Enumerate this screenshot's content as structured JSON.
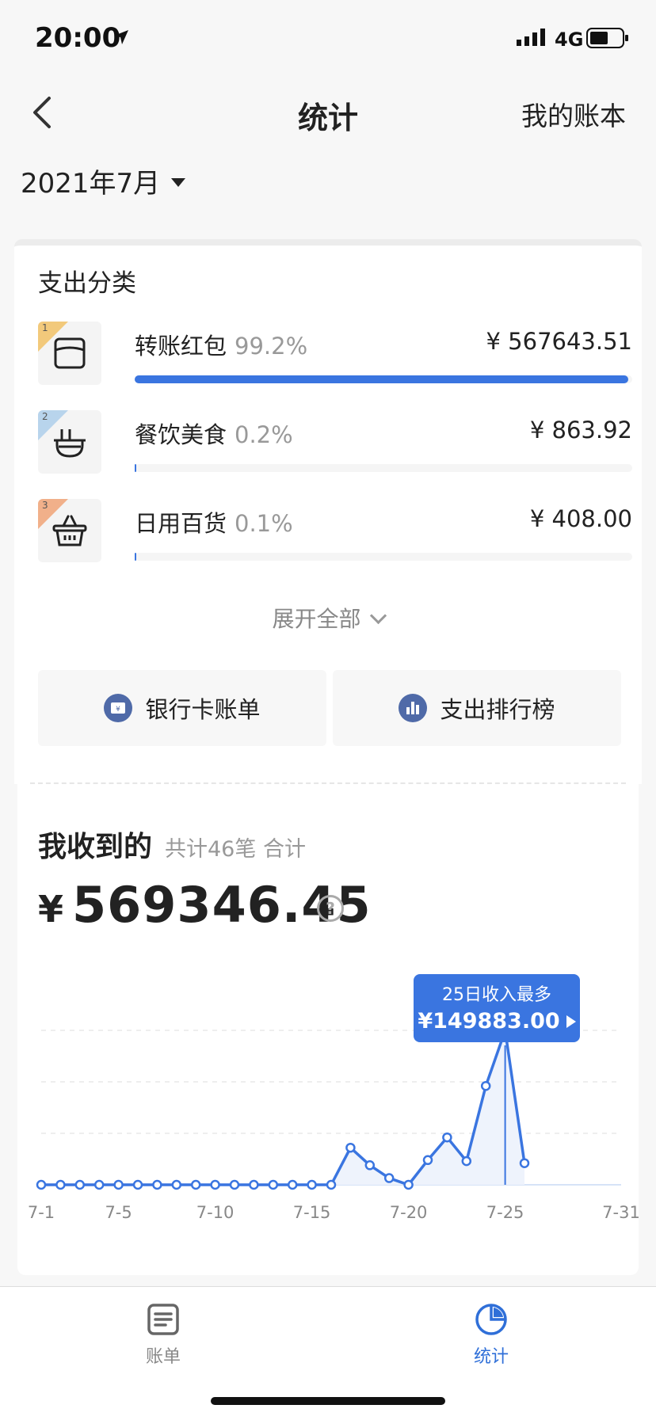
{
  "status_bar": {
    "time": "20:00",
    "network": "4G"
  },
  "nav": {
    "title": "统计",
    "right_link": "我的账本"
  },
  "period": {
    "label": "2021年7月"
  },
  "expense_section": {
    "title": "支出分类",
    "categories": [
      {
        "rank": "1",
        "name": "转账红包",
        "percent": "99.2%",
        "amount": "¥ 567643.51",
        "share": 0.992,
        "icon": "wallet-icon"
      },
      {
        "rank": "2",
        "name": "餐饮美食",
        "percent": "0.2%",
        "amount": "¥ 863.92",
        "share": 0.002,
        "icon": "bowl-icon"
      },
      {
        "rank": "3",
        "name": "日用百货",
        "percent": "0.1%",
        "amount": "¥ 408.00",
        "share": 0.001,
        "icon": "basket-icon"
      }
    ],
    "expand_label": "展开全部",
    "actions": [
      {
        "label": "银行卡账单",
        "icon": "bank-card-icon"
      },
      {
        "label": "支出排行榜",
        "icon": "bar-chart-icon"
      }
    ]
  },
  "income_section": {
    "title": "我收到的",
    "subtitle": "共计46笔 合计",
    "currency": "¥",
    "total": "569346.45",
    "tooltip": {
      "title": "25日收入最多",
      "value": "¥149883.00"
    }
  },
  "chart_data": {
    "type": "line",
    "x": [
      "7-1",
      "7-2",
      "7-3",
      "7-4",
      "7-5",
      "7-6",
      "7-7",
      "7-8",
      "7-9",
      "7-10",
      "7-11",
      "7-12",
      "7-13",
      "7-14",
      "7-15",
      "7-16",
      "7-17",
      "7-18",
      "7-19",
      "7-20",
      "7-21",
      "7-22",
      "7-23",
      "7-24",
      "7-25",
      "7-26"
    ],
    "values": [
      0,
      0,
      0,
      0,
      0,
      0,
      0,
      0,
      0,
      0,
      0,
      0,
      0,
      0,
      0,
      0,
      36000,
      19000,
      6500,
      0,
      24000,
      46000,
      23000,
      96000,
      149883,
      21000
    ],
    "tick_labels": [
      "7-1",
      "7-5",
      "7-10",
      "7-15",
      "7-20",
      "7-25",
      "7-31"
    ],
    "tick_days": [
      1,
      5,
      10,
      15,
      20,
      25,
      31
    ],
    "ylim": [
      0,
      200000
    ],
    "highlight_day": 25,
    "line_color": "#3a75e0"
  },
  "tab_bar": {
    "tabs": [
      {
        "label": "账单",
        "icon": "document-icon",
        "active": false
      },
      {
        "label": "统计",
        "icon": "pie-chart-icon",
        "active": true
      }
    ]
  }
}
